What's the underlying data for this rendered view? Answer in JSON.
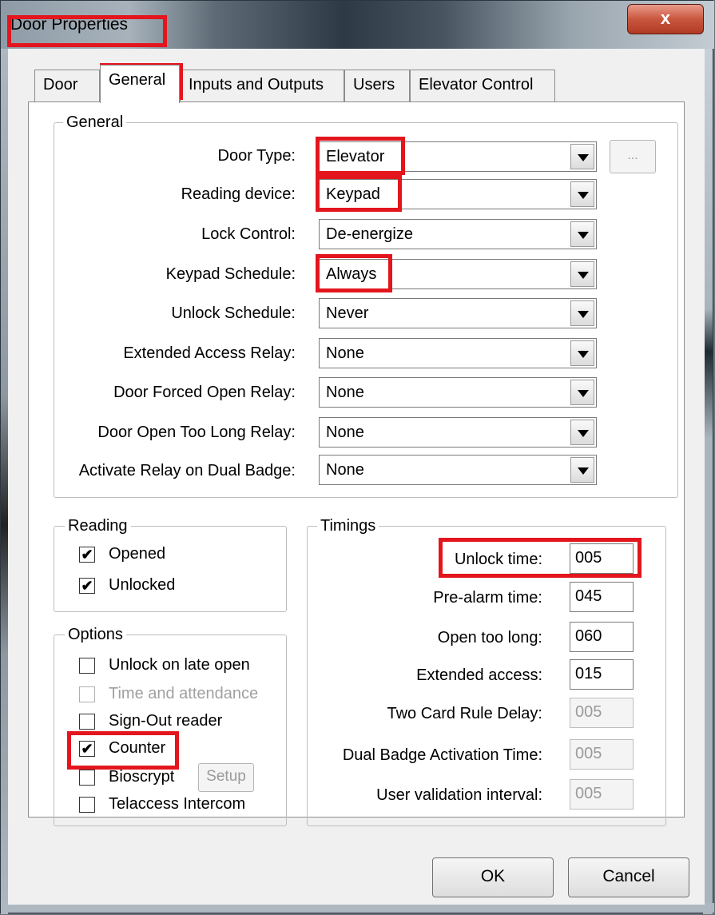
{
  "window": {
    "title": "Door Properties",
    "close_glyph": "x"
  },
  "tabs": [
    {
      "label": "Door"
    },
    {
      "label": "General"
    },
    {
      "label": "Inputs and Outputs"
    },
    {
      "label": "Users"
    },
    {
      "label": "Elevator Control"
    }
  ],
  "active_tab": "General",
  "general": {
    "group_label": "General",
    "fields": [
      {
        "label": "Door Type:",
        "value": "Elevator"
      },
      {
        "label": "Reading device:",
        "value": "Keypad"
      },
      {
        "label": "Lock Control:",
        "value": "De-energize"
      },
      {
        "label": "Keypad Schedule:",
        "value": "Always"
      },
      {
        "label": "Unlock Schedule:",
        "value": "Never"
      },
      {
        "label": "Extended Access Relay:",
        "value": "None"
      },
      {
        "label": "Door Forced Open Relay:",
        "value": "None"
      },
      {
        "label": "Door Open Too Long Relay:",
        "value": "None"
      },
      {
        "label": "Activate Relay on Dual Badge:",
        "value": "None"
      }
    ],
    "ellipsis_label": "..."
  },
  "reading": {
    "group_label": "Reading",
    "items": [
      {
        "label": "Opened",
        "checked": true
      },
      {
        "label": "Unlocked",
        "checked": true
      }
    ]
  },
  "options": {
    "group_label": "Options",
    "items": [
      {
        "label": "Unlock on late open",
        "checked": false,
        "enabled": true
      },
      {
        "label": "Time and attendance",
        "checked": false,
        "enabled": false
      },
      {
        "label": "Sign-Out reader",
        "checked": false,
        "enabled": true
      },
      {
        "label": "Counter",
        "checked": true,
        "enabled": true
      },
      {
        "label": "Bioscrypt",
        "checked": false,
        "enabled": true
      },
      {
        "label": "Telaccess Intercom",
        "checked": false,
        "enabled": true
      }
    ],
    "setup_label": "Setup"
  },
  "timings": {
    "group_label": "Timings",
    "items": [
      {
        "label": "Unlock time:",
        "value": "005",
        "enabled": true
      },
      {
        "label": "Pre-alarm time:",
        "value": "045",
        "enabled": true
      },
      {
        "label": "Open too long:",
        "value": "060",
        "enabled": true
      },
      {
        "label": "Extended access:",
        "value": "015",
        "enabled": true
      },
      {
        "label": "Two Card Rule Delay:",
        "value": "005",
        "enabled": false
      },
      {
        "label": "Dual Badge Activation Time:",
        "value": "005",
        "enabled": false
      },
      {
        "label": "User validation interval:",
        "value": "005",
        "enabled": false
      }
    ]
  },
  "buttons": {
    "ok": "OK",
    "cancel": "Cancel"
  },
  "colors": {
    "highlight": "#e3151d",
    "window_bg": "#f0f0f0",
    "panel_bg": "#ffffff"
  },
  "check_glyph": "✔"
}
